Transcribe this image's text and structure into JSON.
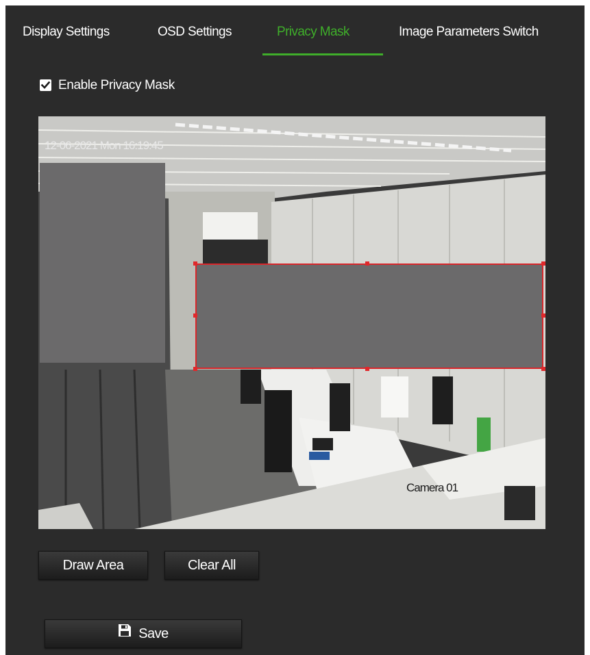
{
  "tabs": [
    {
      "label": "Display Settings",
      "active": false
    },
    {
      "label": "OSD Settings",
      "active": false
    },
    {
      "label": "Privacy Mask",
      "active": true
    },
    {
      "label": "Image Parameters Switch",
      "active": false
    }
  ],
  "privacy_mask": {
    "enable_label": "Enable Privacy Mask",
    "enabled": true
  },
  "video": {
    "osd_datetime": "12-06-2021 Mon 16:19:45",
    "osd_camera_name": "Camera 01"
  },
  "buttons": {
    "draw_area": "Draw Area",
    "clear_all": "Clear All",
    "save": "Save"
  },
  "icons": {
    "checkbox": "check-icon",
    "save": "floppy-disk-icon"
  },
  "colors": {
    "panel_background": "#2b2b2b",
    "active_tab": "#3fae2a",
    "mask_fill": "#6b6a6b",
    "selection_outline": "#d9262a"
  }
}
